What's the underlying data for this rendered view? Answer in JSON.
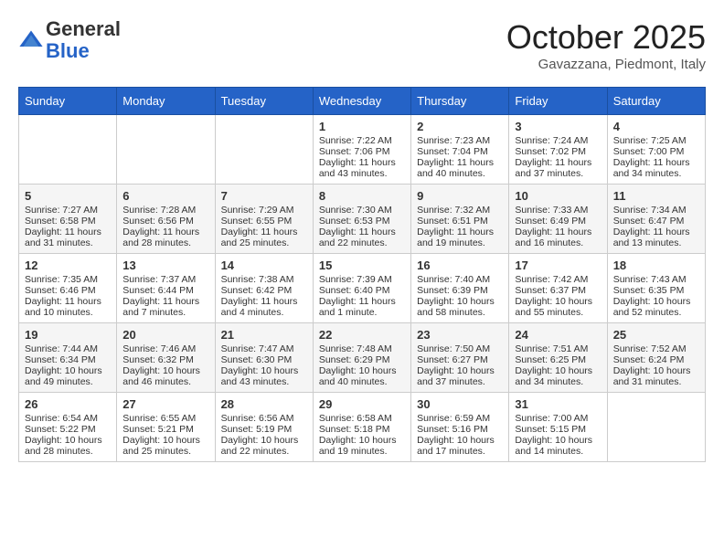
{
  "header": {
    "logo_line1": "General",
    "logo_line2": "Blue",
    "month_title": "October 2025",
    "location": "Gavazzana, Piedmont, Italy"
  },
  "days_of_week": [
    "Sunday",
    "Monday",
    "Tuesday",
    "Wednesday",
    "Thursday",
    "Friday",
    "Saturday"
  ],
  "weeks": [
    [
      {
        "day": "",
        "info": ""
      },
      {
        "day": "",
        "info": ""
      },
      {
        "day": "",
        "info": ""
      },
      {
        "day": "1",
        "info": "Sunrise: 7:22 AM\nSunset: 7:06 PM\nDaylight: 11 hours and 43 minutes."
      },
      {
        "day": "2",
        "info": "Sunrise: 7:23 AM\nSunset: 7:04 PM\nDaylight: 11 hours and 40 minutes."
      },
      {
        "day": "3",
        "info": "Sunrise: 7:24 AM\nSunset: 7:02 PM\nDaylight: 11 hours and 37 minutes."
      },
      {
        "day": "4",
        "info": "Sunrise: 7:25 AM\nSunset: 7:00 PM\nDaylight: 11 hours and 34 minutes."
      }
    ],
    [
      {
        "day": "5",
        "info": "Sunrise: 7:27 AM\nSunset: 6:58 PM\nDaylight: 11 hours and 31 minutes."
      },
      {
        "day": "6",
        "info": "Sunrise: 7:28 AM\nSunset: 6:56 PM\nDaylight: 11 hours and 28 minutes."
      },
      {
        "day": "7",
        "info": "Sunrise: 7:29 AM\nSunset: 6:55 PM\nDaylight: 11 hours and 25 minutes."
      },
      {
        "day": "8",
        "info": "Sunrise: 7:30 AM\nSunset: 6:53 PM\nDaylight: 11 hours and 22 minutes."
      },
      {
        "day": "9",
        "info": "Sunrise: 7:32 AM\nSunset: 6:51 PM\nDaylight: 11 hours and 19 minutes."
      },
      {
        "day": "10",
        "info": "Sunrise: 7:33 AM\nSunset: 6:49 PM\nDaylight: 11 hours and 16 minutes."
      },
      {
        "day": "11",
        "info": "Sunrise: 7:34 AM\nSunset: 6:47 PM\nDaylight: 11 hours and 13 minutes."
      }
    ],
    [
      {
        "day": "12",
        "info": "Sunrise: 7:35 AM\nSunset: 6:46 PM\nDaylight: 11 hours and 10 minutes."
      },
      {
        "day": "13",
        "info": "Sunrise: 7:37 AM\nSunset: 6:44 PM\nDaylight: 11 hours and 7 minutes."
      },
      {
        "day": "14",
        "info": "Sunrise: 7:38 AM\nSunset: 6:42 PM\nDaylight: 11 hours and 4 minutes."
      },
      {
        "day": "15",
        "info": "Sunrise: 7:39 AM\nSunset: 6:40 PM\nDaylight: 11 hours and 1 minute."
      },
      {
        "day": "16",
        "info": "Sunrise: 7:40 AM\nSunset: 6:39 PM\nDaylight: 10 hours and 58 minutes."
      },
      {
        "day": "17",
        "info": "Sunrise: 7:42 AM\nSunset: 6:37 PM\nDaylight: 10 hours and 55 minutes."
      },
      {
        "day": "18",
        "info": "Sunrise: 7:43 AM\nSunset: 6:35 PM\nDaylight: 10 hours and 52 minutes."
      }
    ],
    [
      {
        "day": "19",
        "info": "Sunrise: 7:44 AM\nSunset: 6:34 PM\nDaylight: 10 hours and 49 minutes."
      },
      {
        "day": "20",
        "info": "Sunrise: 7:46 AM\nSunset: 6:32 PM\nDaylight: 10 hours and 46 minutes."
      },
      {
        "day": "21",
        "info": "Sunrise: 7:47 AM\nSunset: 6:30 PM\nDaylight: 10 hours and 43 minutes."
      },
      {
        "day": "22",
        "info": "Sunrise: 7:48 AM\nSunset: 6:29 PM\nDaylight: 10 hours and 40 minutes."
      },
      {
        "day": "23",
        "info": "Sunrise: 7:50 AM\nSunset: 6:27 PM\nDaylight: 10 hours and 37 minutes."
      },
      {
        "day": "24",
        "info": "Sunrise: 7:51 AM\nSunset: 6:25 PM\nDaylight: 10 hours and 34 minutes."
      },
      {
        "day": "25",
        "info": "Sunrise: 7:52 AM\nSunset: 6:24 PM\nDaylight: 10 hours and 31 minutes."
      }
    ],
    [
      {
        "day": "26",
        "info": "Sunrise: 6:54 AM\nSunset: 5:22 PM\nDaylight: 10 hours and 28 minutes."
      },
      {
        "day": "27",
        "info": "Sunrise: 6:55 AM\nSunset: 5:21 PM\nDaylight: 10 hours and 25 minutes."
      },
      {
        "day": "28",
        "info": "Sunrise: 6:56 AM\nSunset: 5:19 PM\nDaylight: 10 hours and 22 minutes."
      },
      {
        "day": "29",
        "info": "Sunrise: 6:58 AM\nSunset: 5:18 PM\nDaylight: 10 hours and 19 minutes."
      },
      {
        "day": "30",
        "info": "Sunrise: 6:59 AM\nSunset: 5:16 PM\nDaylight: 10 hours and 17 minutes."
      },
      {
        "day": "31",
        "info": "Sunrise: 7:00 AM\nSunset: 5:15 PM\nDaylight: 10 hours and 14 minutes."
      },
      {
        "day": "",
        "info": ""
      }
    ]
  ]
}
